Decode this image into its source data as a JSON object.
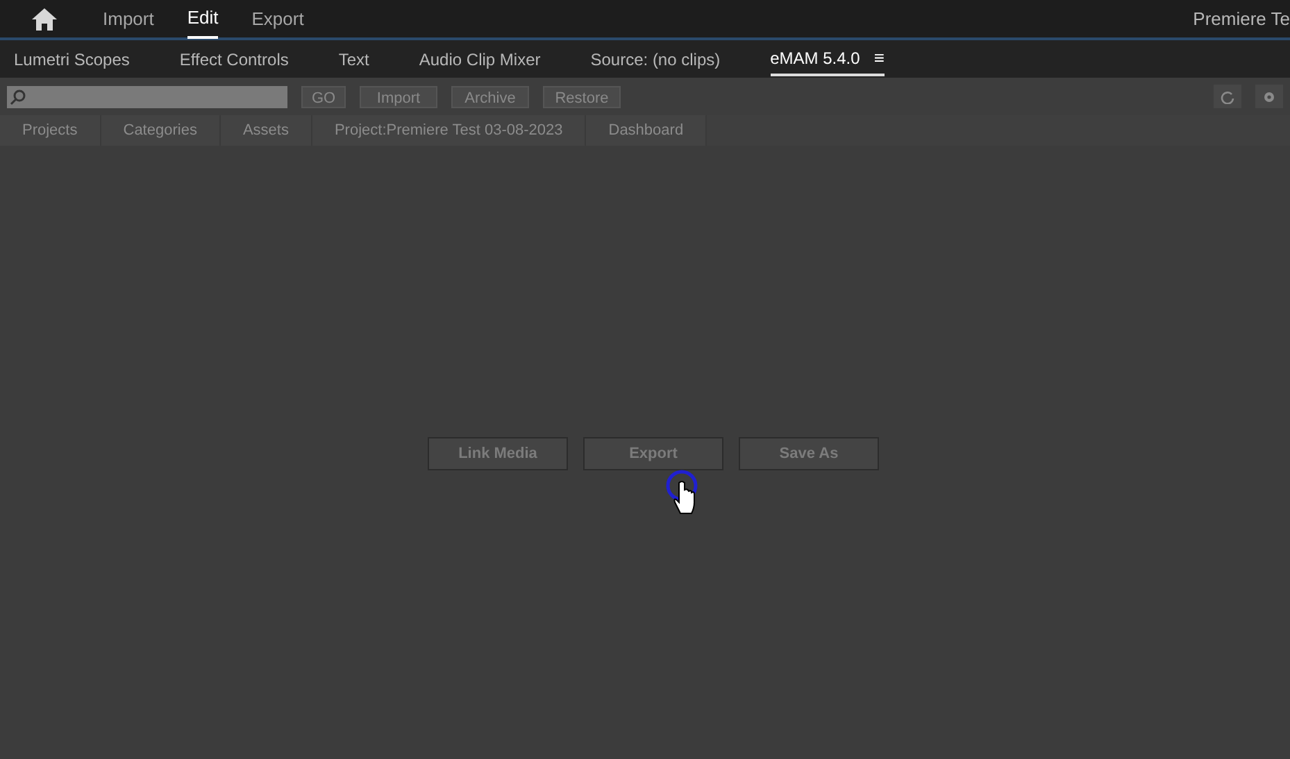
{
  "header": {
    "nav": [
      {
        "label": "Import",
        "selected": false
      },
      {
        "label": "Edit",
        "selected": true
      },
      {
        "label": "Export",
        "selected": false
      }
    ],
    "project_title": "Premiere Te"
  },
  "panel_tabs": [
    {
      "label": "Lumetri Scopes",
      "selected": false
    },
    {
      "label": "Effect Controls",
      "selected": false
    },
    {
      "label": "Text",
      "selected": false
    },
    {
      "label": "Audio Clip Mixer",
      "selected": false
    },
    {
      "label": "Source: (no clips)",
      "selected": false
    },
    {
      "label": "eMAM 5.4.0",
      "selected": true
    }
  ],
  "panel_menu": "≡",
  "toolbar": {
    "buttons": [
      "GO",
      "Import",
      "Archive",
      "Restore"
    ]
  },
  "sub_tabs": [
    {
      "label": "Projects"
    },
    {
      "label": "Categories"
    },
    {
      "label": "Assets"
    },
    {
      "label": "Project:Premiere Test 03-08-2023"
    },
    {
      "label": "Dashboard"
    }
  ],
  "actions": [
    "Link Media",
    "Export",
    "Save As"
  ]
}
